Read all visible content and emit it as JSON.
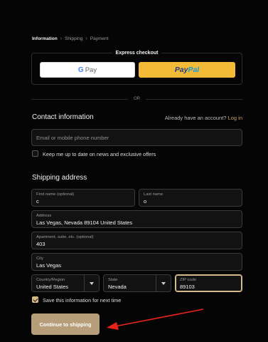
{
  "breadcrumb": [
    "Information",
    "Shipping",
    "Payment"
  ],
  "express_checkout": {
    "title": "Express checkout",
    "gpay_g": "G",
    "gpay_text": "Pay",
    "paypal_a": "Pay",
    "paypal_b": "Pal"
  },
  "divider_text": "OR",
  "contact": {
    "heading": "Contact information",
    "have_account": "Already have an account?",
    "login_link": "Log in",
    "email_placeholder": "Email or mobile phone number",
    "newsletter_label": "Keep me up to date on news and exclusive offers",
    "newsletter_checked": false
  },
  "shipping": {
    "heading": "Shipping address",
    "first_name": {
      "label": "First name (optional)",
      "value": "c"
    },
    "last_name": {
      "label": "Last name",
      "value": "o"
    },
    "address": {
      "label": "Address",
      "value": "Las Vegas, Nevada 89104 United States"
    },
    "apartment": {
      "label": "Apartment, suite, etc. (optional)",
      "value": "403"
    },
    "city": {
      "label": "City",
      "value": "Las Vegas"
    },
    "country": {
      "label": "Country/Region",
      "value": "United States"
    },
    "state": {
      "label": "State",
      "value": "Nevada"
    },
    "zip": {
      "label": "ZIP code",
      "value": "89103"
    },
    "save_info_label": "Save this information for next time",
    "save_info_checked": true
  },
  "continue_button": "Continue to shipping",
  "colors": {
    "accent": "#b79e7a",
    "focus": "#d7b888",
    "annotation_arrow": "#e8231b"
  }
}
